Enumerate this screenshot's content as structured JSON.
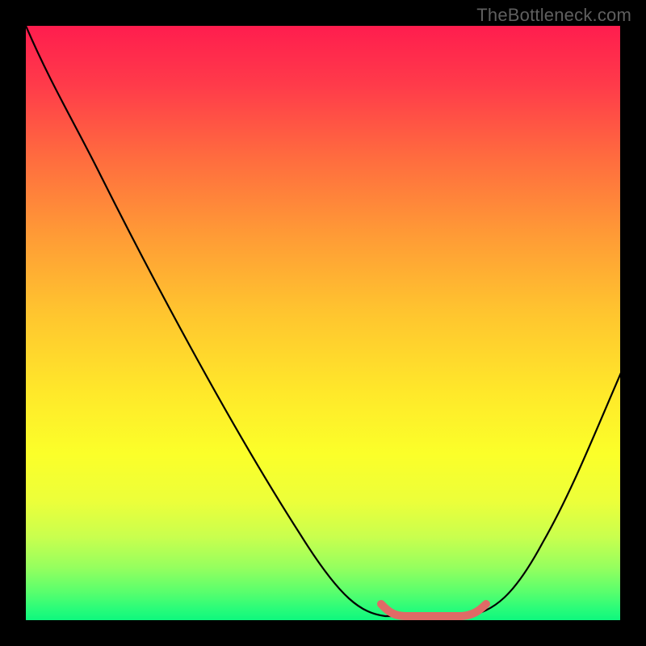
{
  "watermark": "TheBottleneck.com",
  "colors": {
    "background": "#000000",
    "gradient_top": "#ff1d4e",
    "gradient_bottom": "#0ef77e",
    "curve": "#000000",
    "trough_highlight": "#e06a66",
    "watermark_text": "#5f5f5f"
  },
  "chart_data": {
    "type": "line",
    "title": "",
    "xlabel": "",
    "ylabel": "",
    "xlim": [
      0,
      100
    ],
    "ylim": [
      0,
      100
    ],
    "grid": false,
    "legend": false,
    "description": "Single black curve on a vertical red→green gradient. Curve descends from top-left to a flat minimum near the bottom around x≈60-75, then rises toward the right edge. A short salmon-colored stroke highlights the flat trough.",
    "series": [
      {
        "name": "bottleneck-curve",
        "x": [
          0,
          4,
          8,
          12,
          20,
          34,
          46,
          53,
          56,
          60,
          65,
          70,
          74,
          77,
          82,
          87,
          92,
          97,
          100
        ],
        "values": [
          100,
          91,
          84,
          76,
          59,
          34,
          15,
          4,
          1,
          0.7,
          0.7,
          0.7,
          1,
          4,
          13,
          23,
          33,
          42,
          46
        ]
      }
    ],
    "annotations": [
      {
        "name": "trough-highlight",
        "x_start": 60,
        "x_end": 77,
        "y": 0.7,
        "color": "#e06a66"
      }
    ]
  }
}
